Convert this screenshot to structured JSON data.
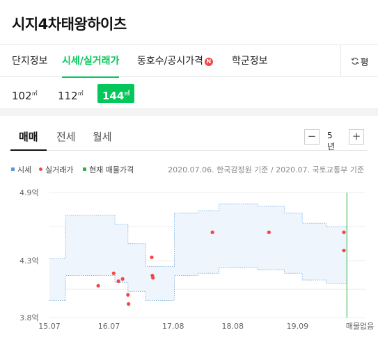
{
  "header": {
    "title": "시지4차태왕하이츠"
  },
  "tabs": [
    {
      "label": "단지정보",
      "active": false
    },
    {
      "label": "시세/실거래가",
      "active": true
    },
    {
      "label": "동호수/공시가격",
      "active": false,
      "badge": "N"
    },
    {
      "label": "학군정보",
      "active": false
    }
  ],
  "tab_right": {
    "label": "평",
    "icon": "refresh-icon"
  },
  "sizes": [
    {
      "num": "102",
      "unit": "㎡",
      "active": false
    },
    {
      "num": "112",
      "unit": "㎡",
      "active": false
    },
    {
      "num": "144",
      "unit": "㎡",
      "active": true
    }
  ],
  "subtabs": [
    {
      "label": "매매",
      "active": true
    },
    {
      "label": "전세",
      "active": false
    },
    {
      "label": "월세",
      "active": false
    }
  ],
  "period": {
    "minus": "−",
    "value": "5년",
    "plus": "+"
  },
  "legend": {
    "items": [
      {
        "label": "시세",
        "color": "#5b9bd5"
      },
      {
        "label": "실거래가",
        "color": "#f04848"
      },
      {
        "label": "현재 매물가격",
        "color": "#2fb34a"
      }
    ],
    "source": "2020.07.06. 한국감정원 기준 / 2020.07. 국토교통부 기준"
  },
  "colors": {
    "accent": "#03c75a",
    "band_fill": "#eef5fc",
    "band_line": "#8fb9e3",
    "deal_dot": "#f04848",
    "listing_line": "#2fb34a"
  },
  "chart_data": {
    "type": "area",
    "y_tick_labels": [
      "4.9억",
      "4.3억",
      "3.8억"
    ],
    "y_ticks": [
      4.9,
      4.3,
      3.8
    ],
    "ylim": [
      3.8,
      4.9
    ],
    "x_tick_labels": [
      "15.07",
      "16.07",
      "17.08",
      "18.08",
      "19.09"
    ],
    "x_ticks": [
      2015.5,
      2016.5,
      2017.58,
      2018.58,
      2019.67
    ],
    "xlim": [
      2015.5,
      2020.52
    ],
    "end_label": "매물없음",
    "listing_marker_x": 2020.5,
    "series": [
      {
        "name": "시세",
        "kind": "band",
        "upper": [
          [
            2015.5,
            4.32
          ],
          [
            2015.77,
            4.32
          ],
          [
            2015.77,
            4.7
          ],
          [
            2016.6,
            4.7
          ],
          [
            2016.6,
            4.62
          ],
          [
            2016.82,
            4.62
          ],
          [
            2016.82,
            4.45
          ],
          [
            2017.12,
            4.45
          ],
          [
            2017.12,
            4.25
          ],
          [
            2017.6,
            4.25
          ],
          [
            2017.6,
            4.72
          ],
          [
            2018.0,
            4.72
          ],
          [
            2018.0,
            4.74
          ],
          [
            2018.35,
            4.74
          ],
          [
            2018.35,
            4.8
          ],
          [
            2019.0,
            4.8
          ],
          [
            2019.0,
            4.78
          ],
          [
            2019.45,
            4.78
          ],
          [
            2019.45,
            4.72
          ],
          [
            2019.75,
            4.72
          ],
          [
            2019.75,
            4.63
          ],
          [
            2020.15,
            4.63
          ],
          [
            2020.15,
            4.6
          ],
          [
            2020.5,
            4.6
          ]
        ],
        "lower": [
          [
            2015.5,
            3.95
          ],
          [
            2015.77,
            3.95
          ],
          [
            2015.77,
            4.17
          ],
          [
            2016.6,
            4.17
          ],
          [
            2016.6,
            4.11
          ],
          [
            2016.82,
            4.11
          ],
          [
            2016.82,
            4.03
          ],
          [
            2017.12,
            4.03
          ],
          [
            2017.12,
            3.95
          ],
          [
            2017.6,
            3.95
          ],
          [
            2017.6,
            4.17
          ],
          [
            2018.0,
            4.17
          ],
          [
            2018.0,
            4.19
          ],
          [
            2018.35,
            4.19
          ],
          [
            2018.35,
            4.24
          ],
          [
            2019.0,
            4.24
          ],
          [
            2019.0,
            4.22
          ],
          [
            2019.45,
            4.22
          ],
          [
            2019.45,
            4.19
          ],
          [
            2019.75,
            4.19
          ],
          [
            2019.75,
            4.13
          ],
          [
            2020.15,
            4.13
          ],
          [
            2020.15,
            4.1
          ],
          [
            2020.5,
            4.1
          ]
        ]
      },
      {
        "name": "실거래가",
        "kind": "scatter",
        "points": [
          [
            2016.32,
            4.08
          ],
          [
            2016.58,
            4.19
          ],
          [
            2016.66,
            4.12
          ],
          [
            2016.73,
            4.14
          ],
          [
            2016.82,
            4.0
          ],
          [
            2016.83,
            3.92
          ],
          [
            2017.22,
            4.33
          ],
          [
            2017.23,
            4.17
          ],
          [
            2017.24,
            4.15
          ],
          [
            2018.24,
            4.55
          ],
          [
            2019.19,
            4.55
          ],
          [
            2020.45,
            4.55
          ],
          [
            2020.45,
            4.39
          ]
        ]
      }
    ]
  }
}
